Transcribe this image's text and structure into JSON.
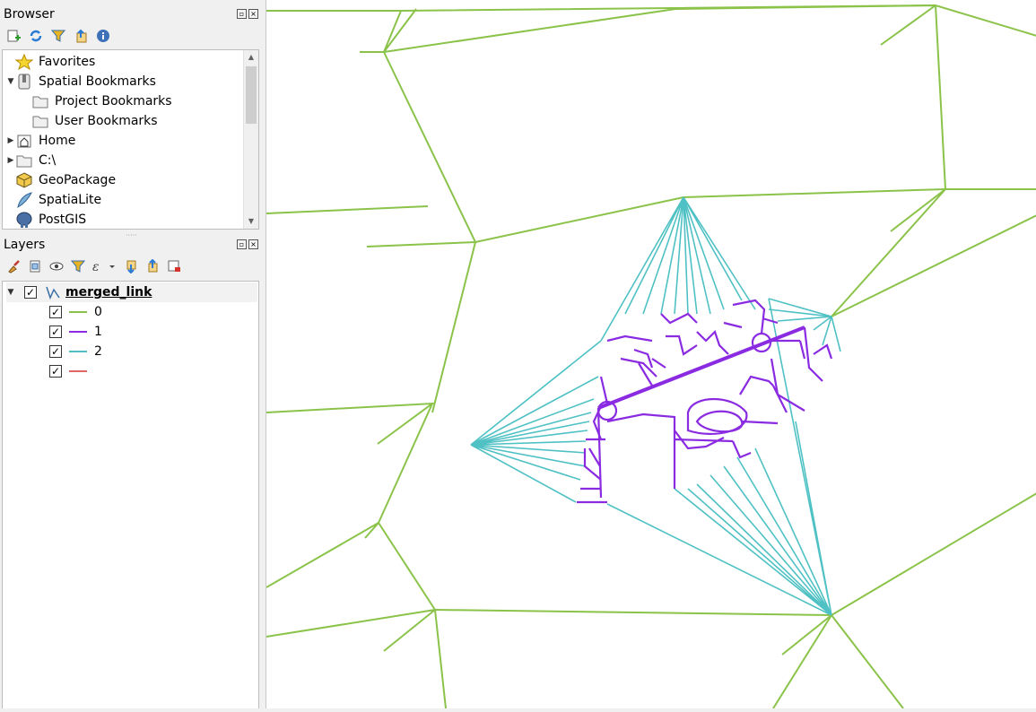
{
  "browser": {
    "title": "Browser",
    "items": [
      {
        "label": "Favorites",
        "icon": "star-icon"
      },
      {
        "label": "Spatial Bookmarks",
        "icon": "bookmark-icon"
      },
      {
        "label": "Project Bookmarks",
        "icon": "folder-icon"
      },
      {
        "label": "User Bookmarks",
        "icon": "folder-icon"
      },
      {
        "label": "Home",
        "icon": "home-icon"
      },
      {
        "label": "C:\\",
        "icon": "folder-icon"
      },
      {
        "label": "GeoPackage",
        "icon": "geopackage-icon"
      },
      {
        "label": "SpatiaLite",
        "icon": "spatialite-icon"
      },
      {
        "label": "PostGIS",
        "icon": "postgis-icon"
      }
    ]
  },
  "layers": {
    "title": "Layers",
    "layer_name": "merged_link",
    "categories": [
      {
        "label": "0",
        "color": "#8bc34a"
      },
      {
        "label": "1",
        "color": "#8a2be2"
      },
      {
        "label": "2",
        "color": "#4fc1c4"
      },
      {
        "label": "",
        "color": "#e06666"
      }
    ]
  },
  "map": {
    "colors": {
      "cat0": "#8bc34a",
      "cat1": "#8a2be2",
      "cat2": "#4fc1c4"
    }
  }
}
